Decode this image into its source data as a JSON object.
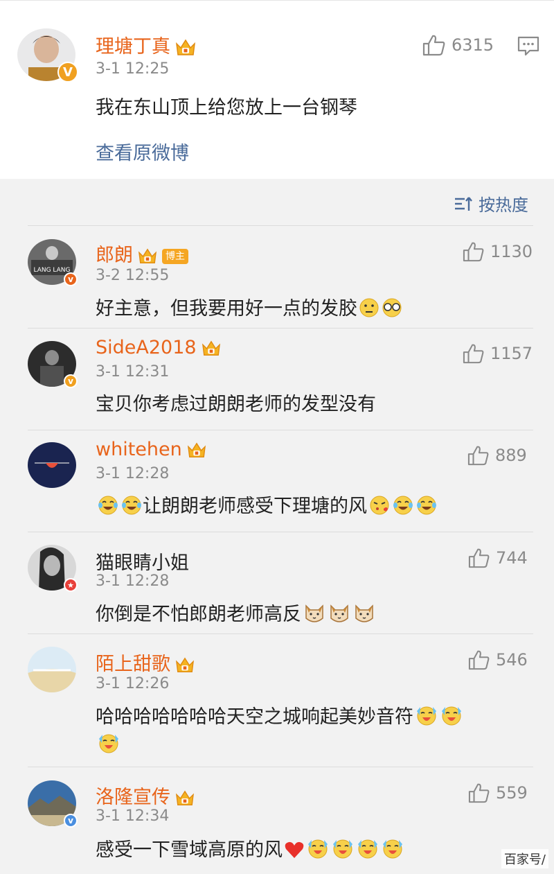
{
  "post": {
    "author": "理塘丁真",
    "time": "3-1 12:25",
    "content": "我在东山顶上给您放上一台钢琴",
    "likes": "6315",
    "view_original": "查看原微博",
    "verified": "V"
  },
  "sort": {
    "label": "按热度"
  },
  "comments": [
    {
      "name": "郎朗",
      "tag": "博主",
      "time": "3-2 12:55",
      "text": "好主意，但我要用好一点的发胶",
      "likes": "1130",
      "badge": "v"
    },
    {
      "name": "SideA2018",
      "time": "3-1 12:31",
      "text": "宝贝你考虑过朗朗老师的发型没有",
      "likes": "1157",
      "badge": "v"
    },
    {
      "name": "whitehen",
      "time": "3-1 12:28",
      "text": "让朗朗老师感受下理塘的风",
      "likes": "889"
    },
    {
      "name": "猫眼睛小姐",
      "time": "3-1 12:28",
      "text": "你倒是不怕郎朗老师高反",
      "likes": "744",
      "badge": "★"
    },
    {
      "name": "陌上甜歌",
      "time": "3-1 12:26",
      "text": "哈哈哈哈哈哈哈天空之城响起美妙音符",
      "likes": "546"
    },
    {
      "name": "洛隆宣传",
      "time": "3-1 12:34",
      "text": "感受一下雪域高原的风",
      "likes": "559",
      "badge": "v"
    }
  ],
  "watermark": "百家号/",
  "colors": {
    "name_orange": "#e8641b",
    "link_blue": "#4a6b9a",
    "verified_gold": "#f0a020"
  }
}
